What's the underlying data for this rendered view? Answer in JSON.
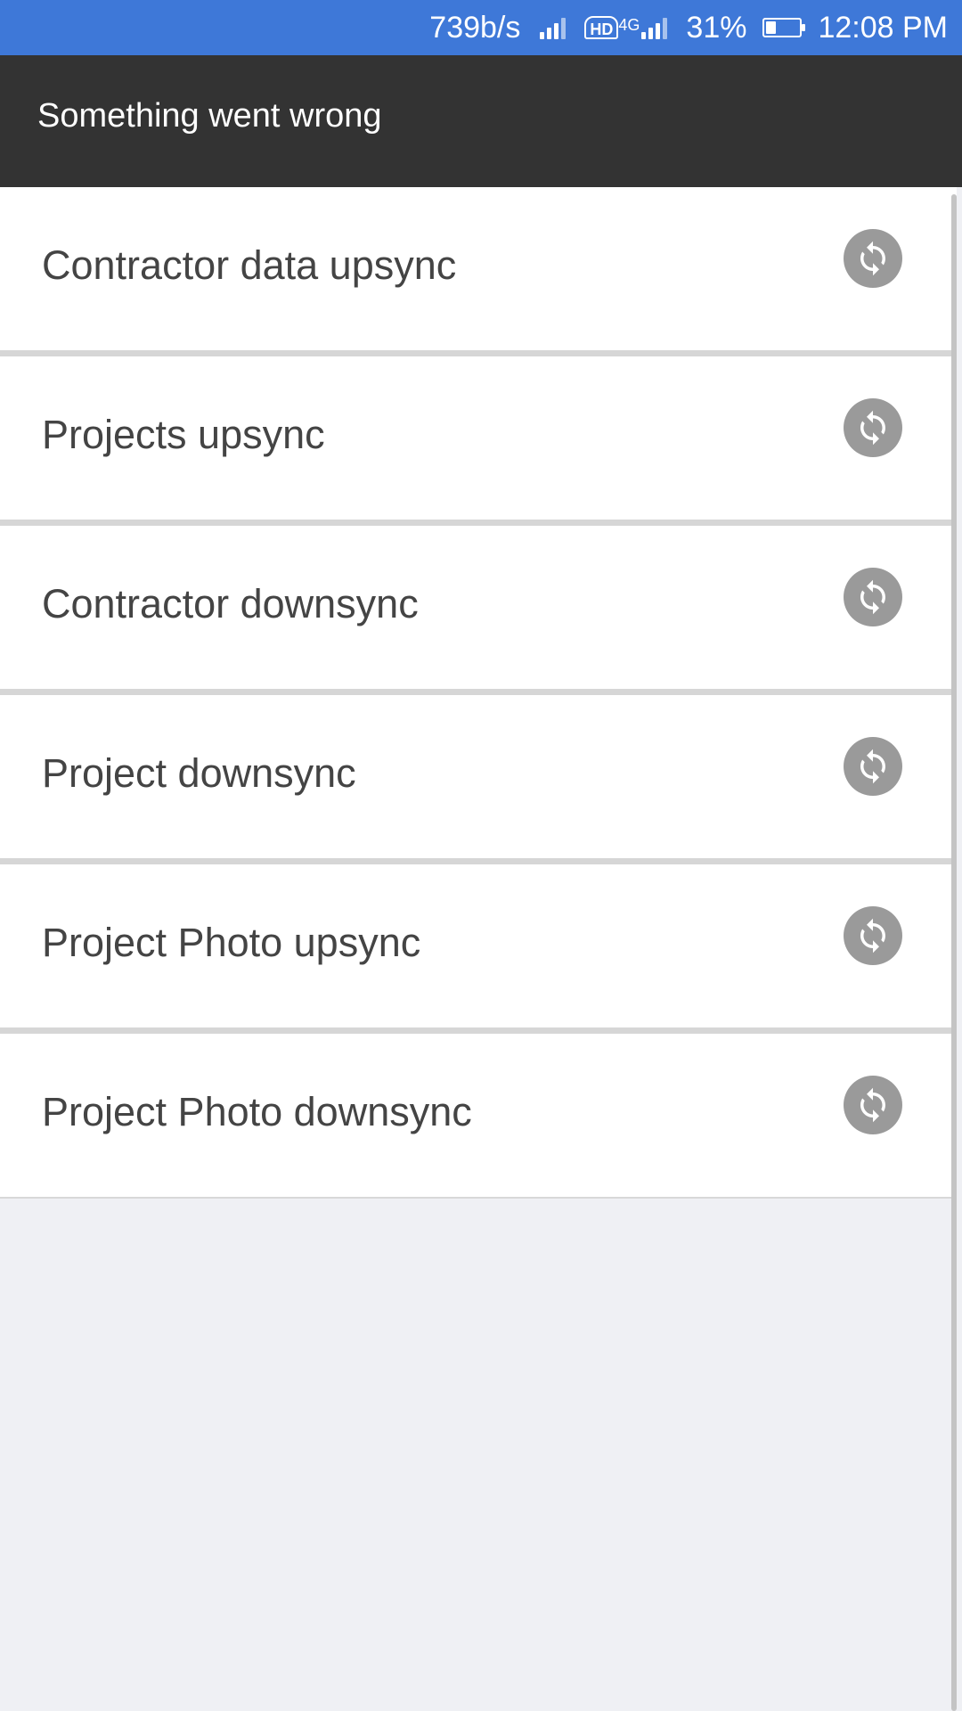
{
  "status_bar": {
    "net_speed": "739b/s",
    "hd_label": "HD",
    "network_type": "4G",
    "battery_percent": "31%",
    "battery_level": 0.31,
    "time": "12:08 PM"
  },
  "app_bar": {
    "title": "Something went wrong"
  },
  "sync_list": {
    "items": [
      {
        "label": "Contractor data upsync",
        "icon": "sync-icon"
      },
      {
        "label": "Projects upsync",
        "icon": "sync-icon"
      },
      {
        "label": "Contractor downsync",
        "icon": "sync-icon"
      },
      {
        "label": "Project downsync",
        "icon": "sync-icon"
      },
      {
        "label": "Project Photo upsync",
        "icon": "sync-icon"
      },
      {
        "label": "Project Photo downsync",
        "icon": "sync-icon"
      }
    ]
  },
  "colors": {
    "status_bar": "#3e78d8",
    "app_bar": "#333333",
    "background": "#eff0f4",
    "sync_button": "#9a9a9a"
  }
}
